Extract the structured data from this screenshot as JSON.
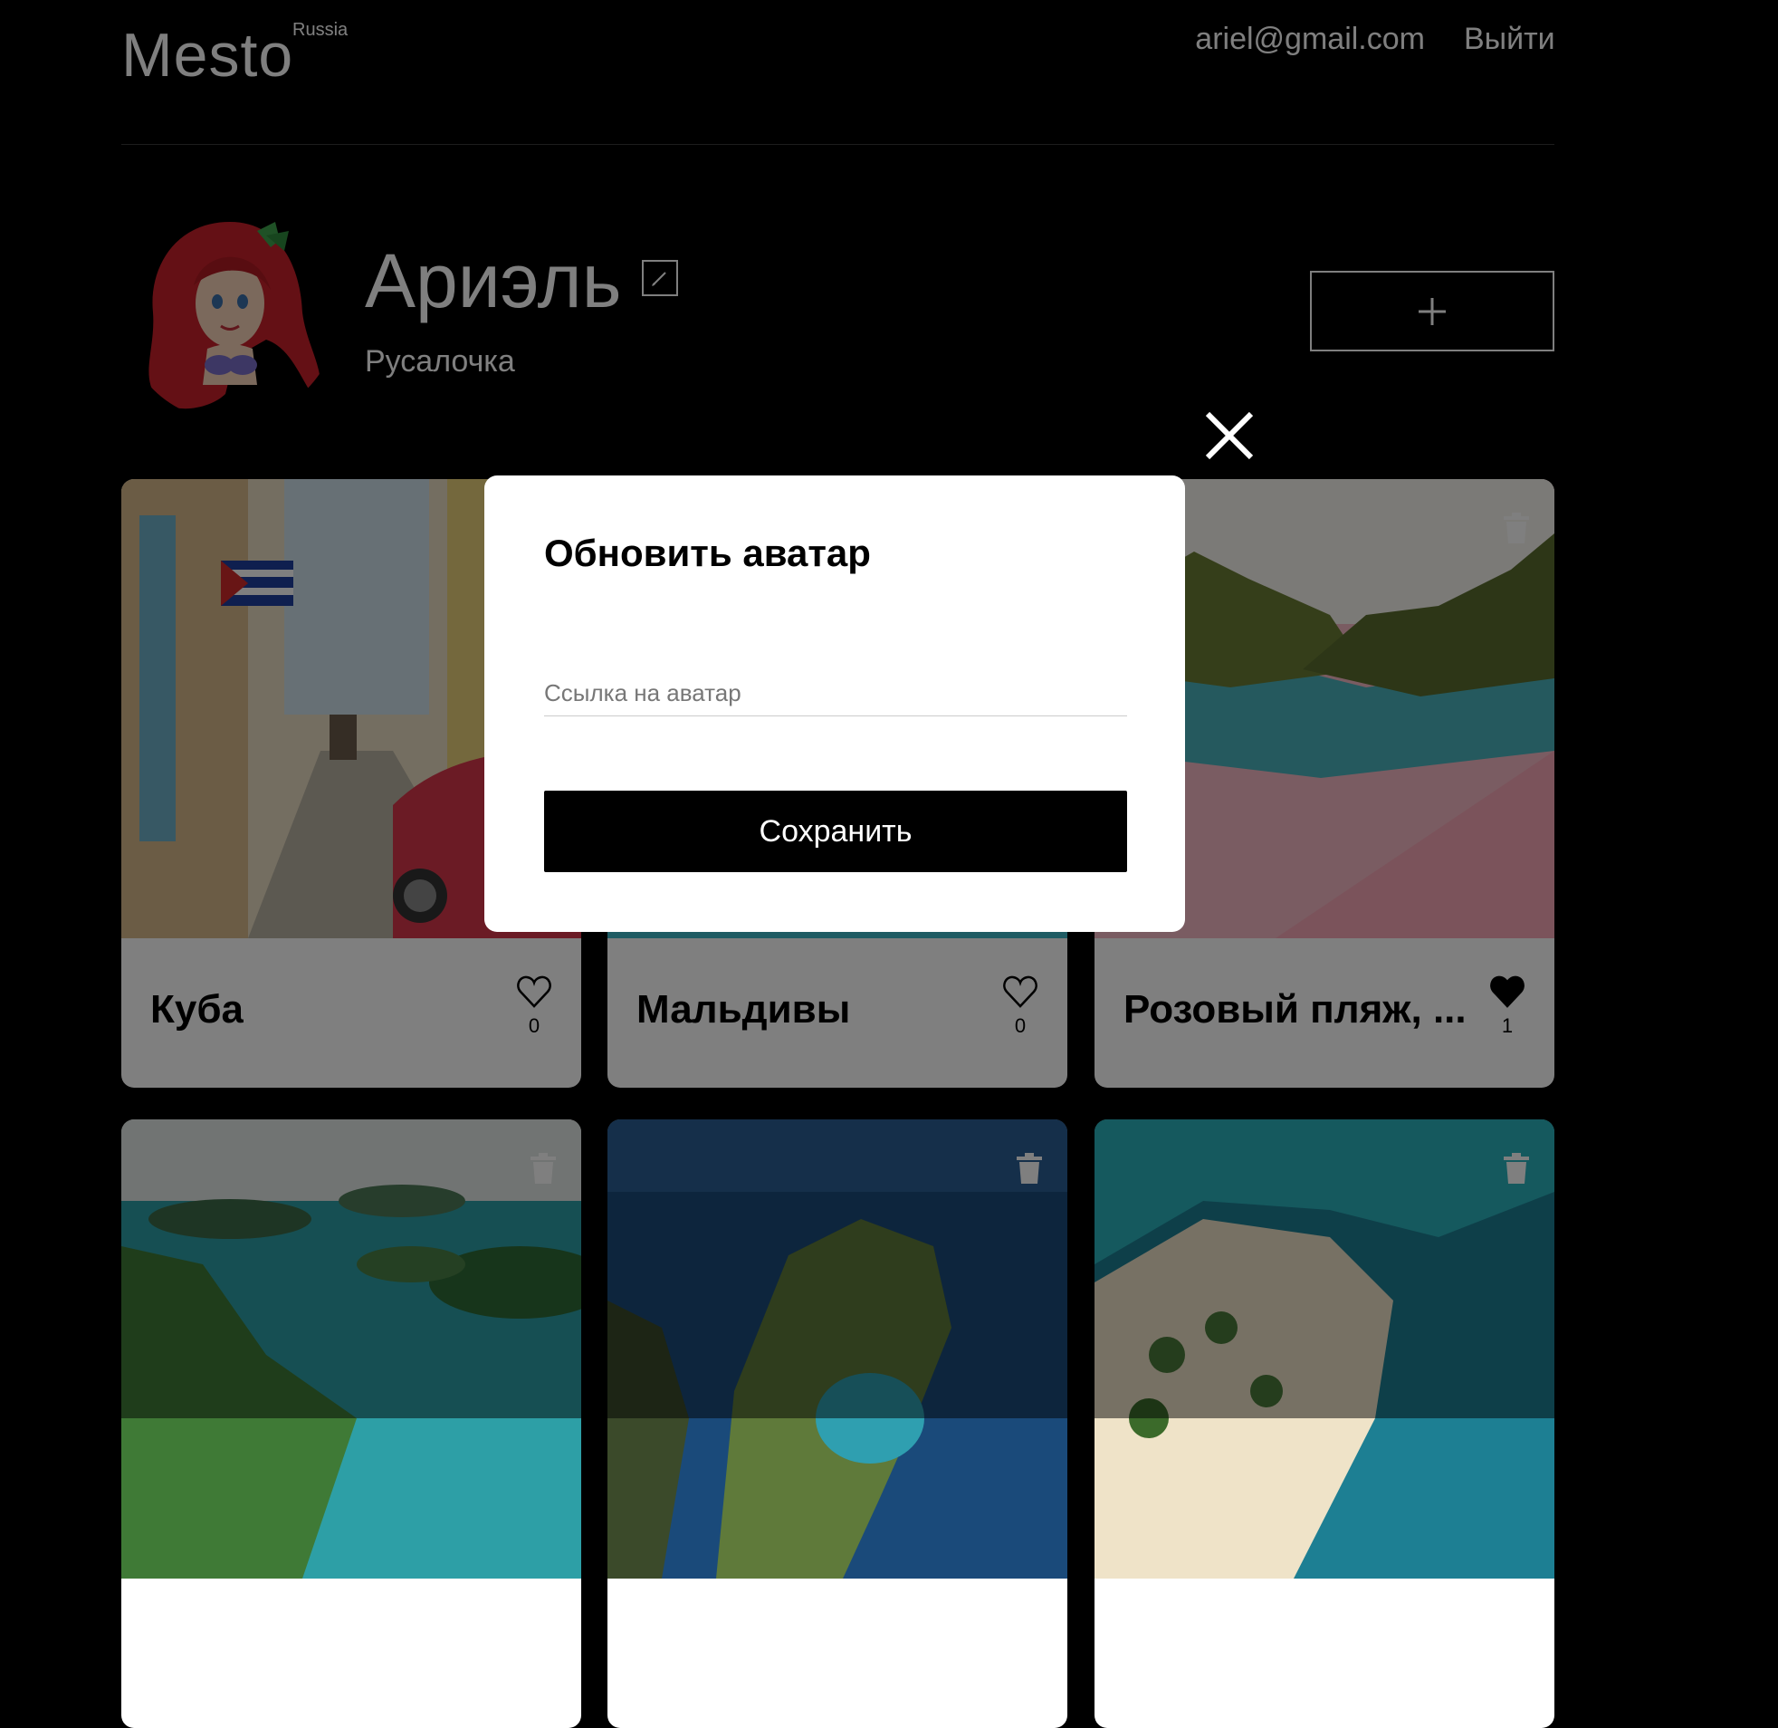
{
  "header": {
    "logo": "Mesto",
    "logo_sub": "Russia",
    "email": "ariel@gmail.com",
    "logout_label": "Выйти"
  },
  "profile": {
    "name": "Ариэль",
    "about": "Русалочка",
    "avatar_icon": "mermaid-avatar"
  },
  "cards": [
    {
      "title": "Куба",
      "likes": "0",
      "liked": false,
      "scene": "cuba-street"
    },
    {
      "title": "Мальдивы",
      "likes": "0",
      "liked": false,
      "scene": "maldives"
    },
    {
      "title": "Розовый пляж, ...",
      "likes": "1",
      "liked": true,
      "scene": "pink-beach"
    },
    {
      "title": "",
      "likes": "",
      "liked": false,
      "scene": "islands"
    },
    {
      "title": "",
      "likes": "",
      "liked": false,
      "scene": "cliff-sea"
    },
    {
      "title": "",
      "likes": "",
      "liked": false,
      "scene": "sand-spit"
    }
  ],
  "modal": {
    "title": "Обновить аватар",
    "input_placeholder": "Ссылка на аватар",
    "input_value": "",
    "save_label": "Сохранить"
  },
  "colors": {
    "background": "#000000",
    "card_bg": "#ffffff",
    "overlay": "rgba(0,0,0,0.5)",
    "button": "#000000"
  }
}
